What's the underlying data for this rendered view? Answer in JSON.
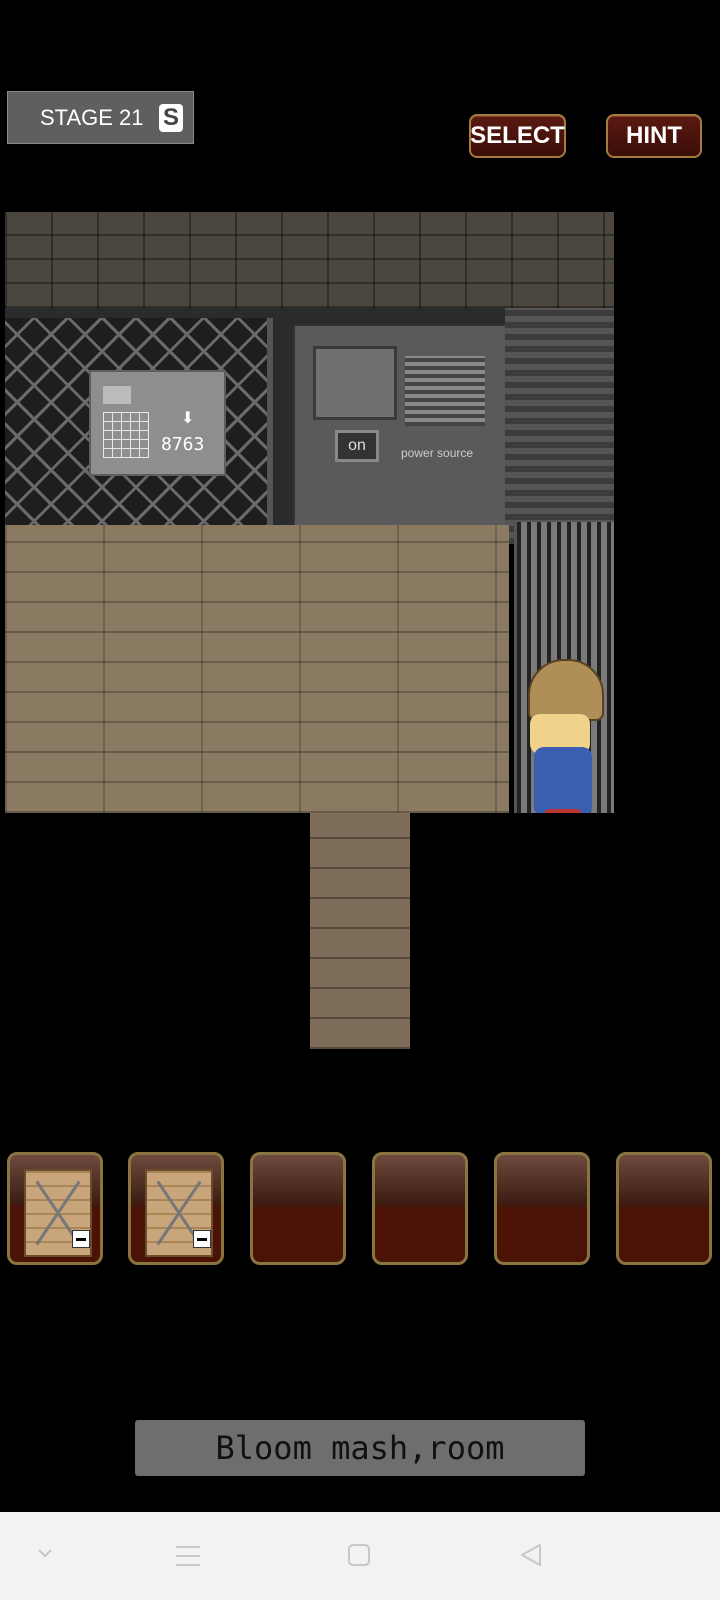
{
  "header": {
    "stage_label": "STAGE 21",
    "stage_badge": "S",
    "select_label": "SELECT",
    "hint_label": "HINT"
  },
  "scene": {
    "panel_code": "8763",
    "on_button_label": "on",
    "power_source_label": "power source"
  },
  "inventory": {
    "slots": [
      {
        "item": "wooden-crate",
        "filled": true
      },
      {
        "item": "wooden-crate",
        "filled": true
      },
      {
        "item": null,
        "filled": false
      },
      {
        "item": null,
        "filled": false
      },
      {
        "item": null,
        "filled": false
      },
      {
        "item": null,
        "filled": false
      }
    ]
  },
  "message": "Bloom mash,room",
  "colors": {
    "button_bg": "#4a1305",
    "button_border": "#a57a3a",
    "slot_border": "#8a7440",
    "background": "#000000",
    "nav_bar": "#f2f2f2"
  },
  "nav_icons": [
    "chevron-down-icon",
    "menu-icon",
    "home-square-icon",
    "back-triangle-icon"
  ]
}
